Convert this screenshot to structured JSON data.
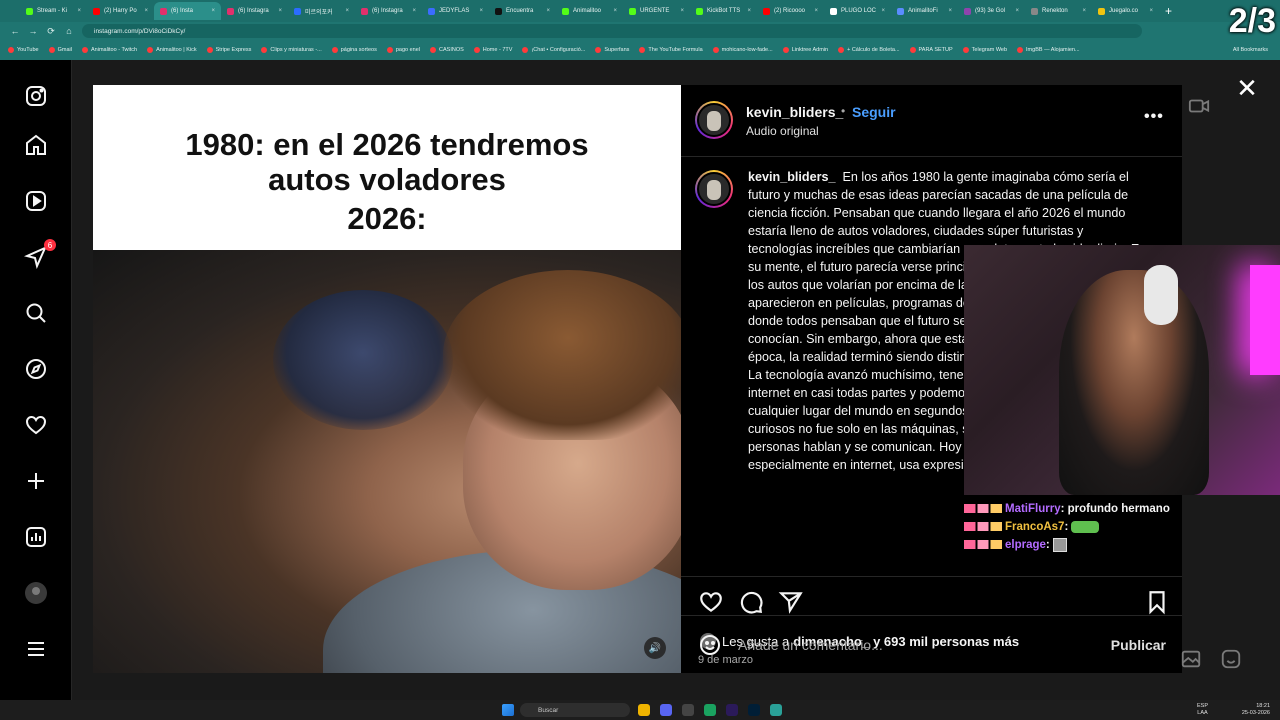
{
  "browser": {
    "tabs": [
      {
        "label": "Stream - Ki",
        "color": "#53fc18",
        "active": false
      },
      {
        "label": "(2) Harry Po",
        "color": "#ff0000",
        "active": false
      },
      {
        "label": "(6) Insta",
        "color": "#e1306c",
        "active": true
      },
      {
        "label": "(6) Instagra",
        "color": "#e1306c",
        "active": false
      },
      {
        "label": "미르의포커",
        "color": "#2b6cff",
        "active": false
      },
      {
        "label": "(6) Instagra",
        "color": "#e1306c",
        "active": false
      },
      {
        "label": "JEDYFLAS",
        "color": "#3b6cff",
        "active": false
      },
      {
        "label": "Encuentra",
        "color": "#111111",
        "active": false
      },
      {
        "label": "Animalitoo",
        "color": "#53fc18",
        "active": false
      },
      {
        "label": "URGENTE",
        "color": "#53fc18",
        "active": false
      },
      {
        "label": "KickBot TTS",
        "color": "#53fc18",
        "active": false
      },
      {
        "label": "(2) Ricoooo",
        "color": "#ff0000",
        "active": false
      },
      {
        "label": "PLUGO LOC",
        "color": "#ffffff",
        "active": false
      },
      {
        "label": "AnimalitoFi",
        "color": "#5b8cff",
        "active": false
      },
      {
        "label": "(93) 3e Gol",
        "color": "#8e44ad",
        "active": false
      },
      {
        "label": "Renekton",
        "color": "#888888",
        "active": false
      },
      {
        "label": "Juegalo.co",
        "color": "#f1c40f",
        "active": false
      }
    ],
    "tab_counter": "2/3",
    "url": "instagram.com/p/DVi8oCiDkCy/",
    "bookmarks": [
      "YouTube",
      "Gmail",
      "Animalitoo - Twitch",
      "Animalitoo | Kick",
      "Stripe Express",
      "Clips y miniaturas -...",
      "página sorteos",
      "pago enel",
      "CASINOS",
      "Home - 7TV",
      "¡Chat • Configuració...",
      "Superfans",
      "The YouTube Formula",
      "mohicano-low-fade...",
      "Linktree Admin",
      "+ Cálculo de Boleta...",
      "PARA SETUP",
      "Telegram Web",
      "ImgBB — Alojamien..."
    ],
    "all_bookmarks": "All Bookmarks"
  },
  "sidebar": {
    "notifications_badge": "6"
  },
  "media": {
    "caption_line1": "1980: en el 2026 tendremos",
    "caption_line2": "autos voladores",
    "caption_line3": "2026:"
  },
  "post": {
    "username": "kevin_bliders_",
    "separator": "•",
    "follow": "Seguir",
    "audio": "Audio original",
    "more": "•••",
    "caption_user": "kevin_bliders_",
    "caption_text": "En los años 1980 la gente imaginaba cómo sería el futuro y muchas de esas ideas parecían sacadas de una película de ciencia ficción. Pensaban que cuando llegara el año 2026 el mundo estaría lleno de autos voladores, ciudades súper futuristas y tecnologías increíbles que cambiarían completamente la vida diaria. En su mente, el futuro parecía verse principalmente en las máquinas y en los autos que volarían por encima de las calles. Durante décadas aparecieron en películas, programas de televisión y conversaciones donde todos pensaban que el futuro sería totalmente diferente a lo que conocían. Sin embargo, ahora que estamos viviendo cerca de esa época, la realidad terminó siendo distinta a lo que muchos imaginaron. La tecnología avanzó muchísimo, tenemos teléfonos inteligentes, internet en casi todas partes y podemos hablar con personas de cualquier lugar del mundo en segundos, pero uno de los cambios más curiosos no fue solo en las máquinas, sino en la forma en que las personas hablan y se comunican. Hoy en día mucha gente, especialmente en internet, usa expresiones que",
    "likes_prefix": "Les gusta a",
    "likes_user": "dimenacho_",
    "likes_suffix": "y 693 mil personas más",
    "date": "9 de marzo",
    "comment_placeholder": "Añade un comentario...",
    "publish": "Publicar"
  },
  "stream_chat": [
    {
      "user": "MatiFlurry",
      "text": "profundo hermano",
      "user_color": "#b36bff"
    },
    {
      "user": "FrancoAs7",
      "text": "",
      "user_color": "#f0c040"
    },
    {
      "user": "elprage",
      "text": "",
      "user_color": "#b36bff"
    }
  ],
  "taskbar": {
    "search": "Buscar",
    "lang": "ESP\nLAA",
    "time": "18:21",
    "date": "25-03-2026"
  }
}
